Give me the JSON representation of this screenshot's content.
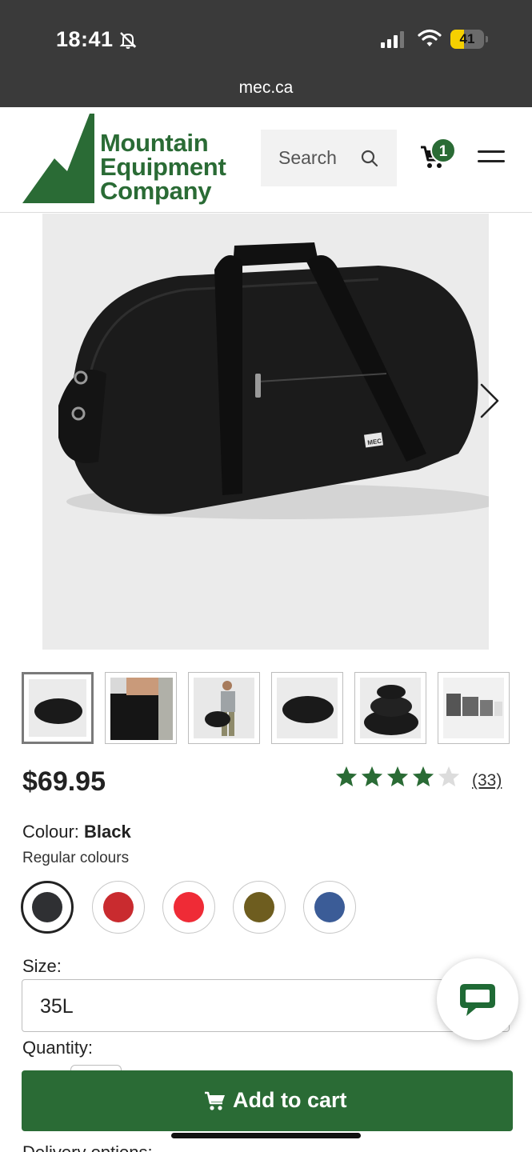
{
  "status_bar": {
    "time": "18:41",
    "battery_level": "41",
    "battery_fraction": 0.41,
    "url": "mec.ca"
  },
  "header": {
    "logo_lines": [
      "Mountain",
      "Equipment",
      "Company"
    ],
    "search_label": "Search",
    "cart_count": "1"
  },
  "product": {
    "image_badge": "MEC",
    "price": "$69.95",
    "rating": {
      "stars": 4,
      "max": 5,
      "review_count": "(33)"
    },
    "colour_label": "Colour:",
    "colour_value": "Black",
    "regular_colours_label": "Regular colours",
    "swatches": [
      {
        "name": "Black",
        "color": "#2f3033",
        "selected": true
      },
      {
        "name": "Dark red",
        "color": "#c92b2f",
        "selected": false
      },
      {
        "name": "Red",
        "color": "#ef2b36",
        "selected": false
      },
      {
        "name": "Olive",
        "color": "#6e5d1f",
        "selected": false
      },
      {
        "name": "Blue",
        "color": "#3b5c97",
        "selected": false
      }
    ],
    "size_label": "Size:",
    "size_value": "35L",
    "quantity_label": "Quantity:",
    "add_to_cart_label": "Add to cart",
    "delivery_label": "Delivery options:"
  },
  "thumbnails": [
    "bag-front",
    "bag-carried",
    "model-shoulder",
    "bag-side",
    "bags-stacked",
    "bags-accessories"
  ],
  "colors": {
    "brand_green": "#2a6b35",
    "status_bar_bg": "#3a3a3a",
    "image_bg": "#ebebeb"
  }
}
